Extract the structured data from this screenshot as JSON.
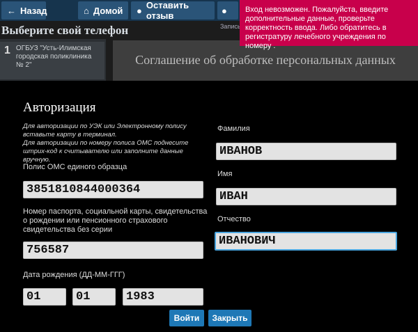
{
  "topbar": {
    "back_label": "Назад",
    "home_label": "Домой",
    "feedback_label": "Оставить отзыв",
    "back_icon": "arrow-left-icon",
    "home_icon": "home-icon",
    "feedback_icon": "speech-bubble-icon"
  },
  "background": {
    "page_title": "Выберите свой телефон",
    "small_text": "Запись",
    "list_item_number": "1",
    "list_item_text": "ОГБУЗ \"Усть-Илимская городская поликлиника № 2\"",
    "content_heading": "Соглашение об обработке персональных данных"
  },
  "toast": {
    "message": "Вход невозможен. Пожалуйста, введите дополнительные данные, проверьте корректность ввода. Либо обратитесь в регистратуру лечебного учреждения по номеру ."
  },
  "modal": {
    "title": "Авторизация",
    "hint": "Для авторизации по УЭК или Электронному полису вставьте карту в терминал.\nДля авторизации по номеру полиса ОМС поднесите штрих-код к считывателю или заполните данные вручную.",
    "policy_label": "Полис ОМС единого образца",
    "policy_value": "3851810844000364",
    "passport_label": "Номер паспорта, социальной карты, свидетельства о рождении или пенсионного страхового свидетельства без серии",
    "passport_value": "756587",
    "birth_label": "Дата рождения (ДД-ММ-ГГГ)",
    "birth_day": "01",
    "birth_month": "01",
    "birth_year": "1983",
    "surname_label": "Фамилия",
    "surname_value": "ИВАНОВ",
    "name_label": "Имя",
    "name_value": "ИВАН",
    "patronymic_label": "Отчество",
    "patronymic_value": "ИВАНОВИЧ",
    "login_button": "Войти",
    "close_button": "Закрыть"
  },
  "colors": {
    "toast_bg": "#c8004b",
    "button_bg": "#1e78b6",
    "focus_border": "#4aa6e0"
  }
}
